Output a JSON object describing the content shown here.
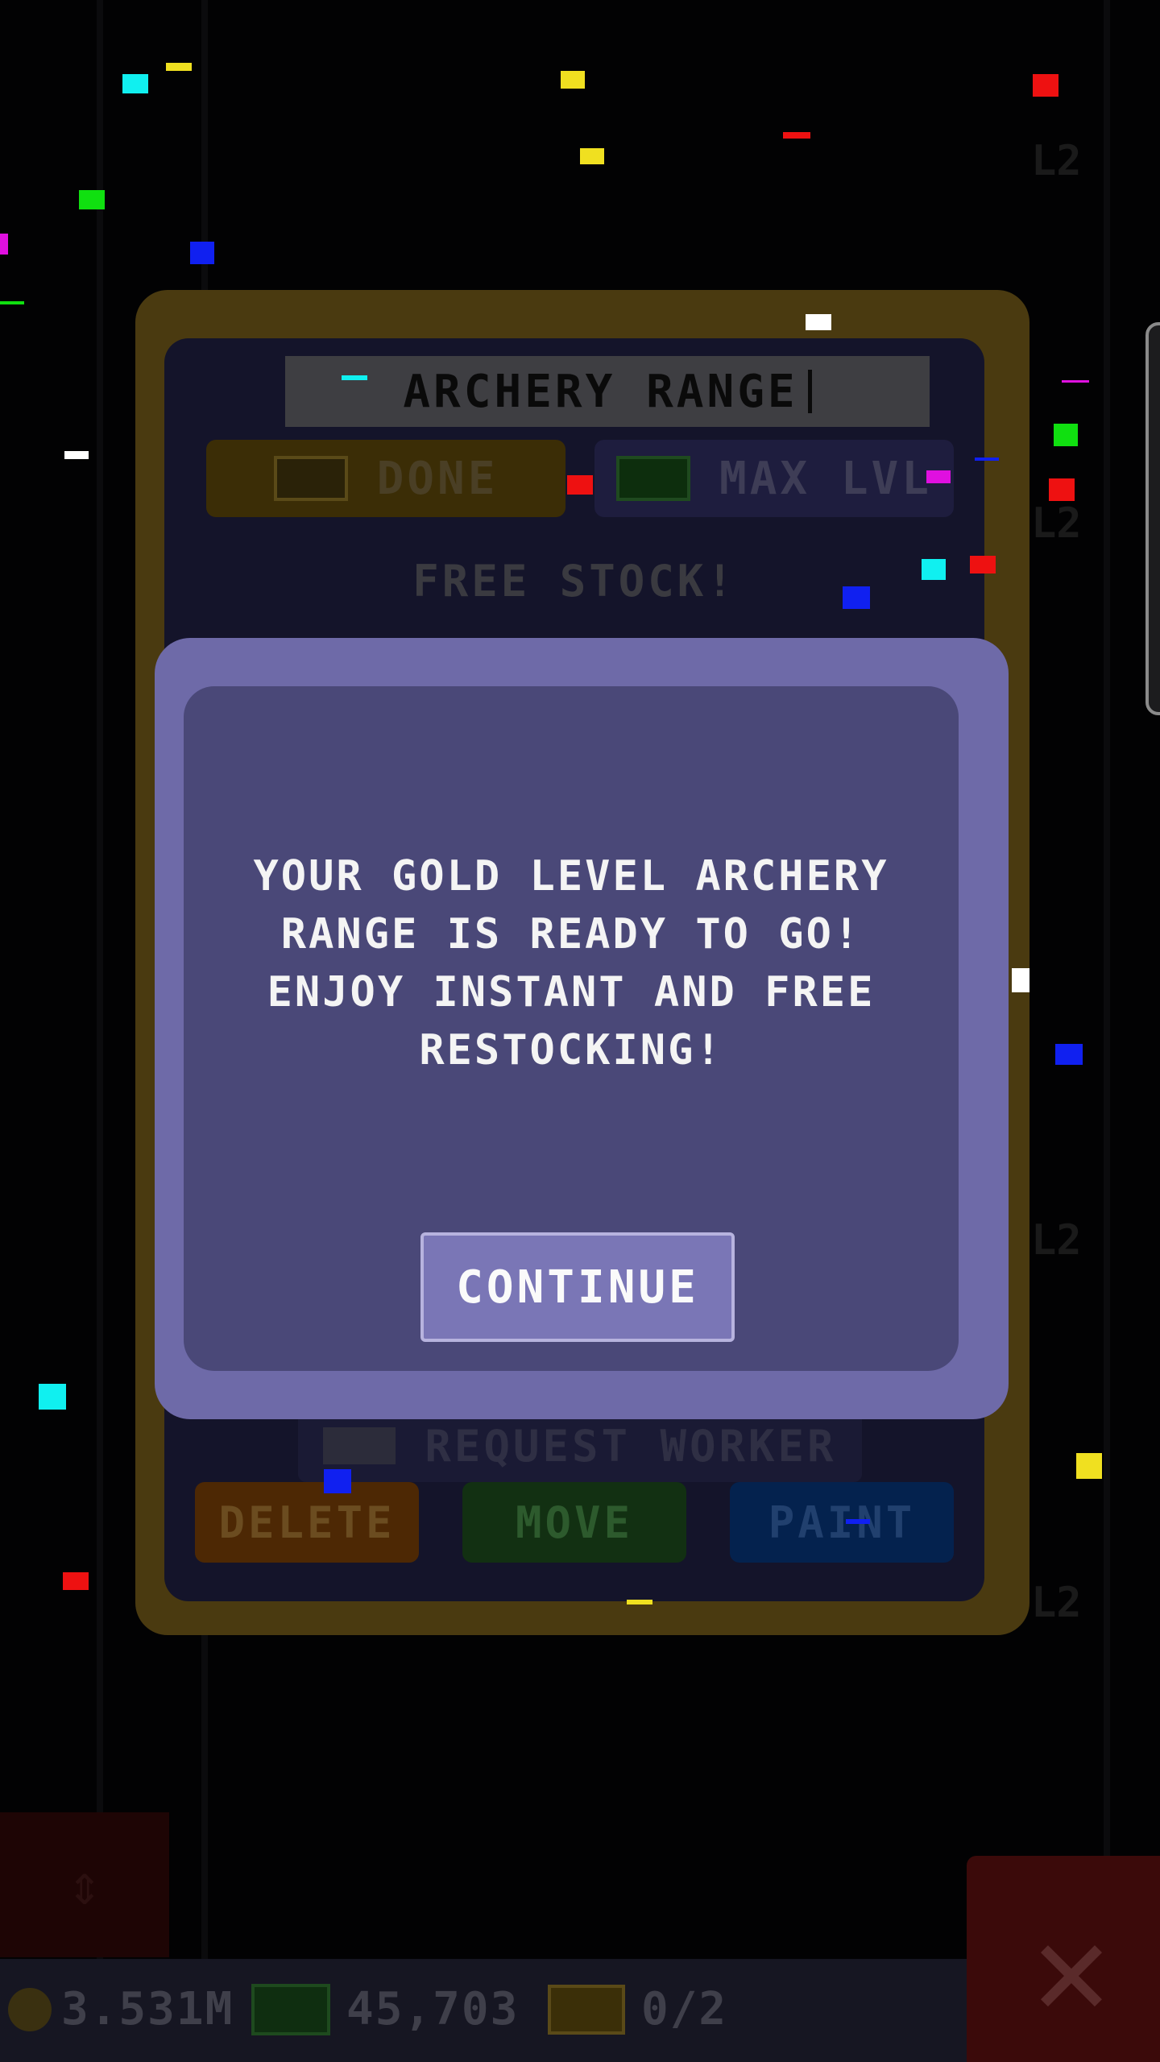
{
  "panel": {
    "title": "ARCHERY RANGE",
    "done_label": "DONE",
    "max_label": "MAX LVL",
    "free_stock": "FREE STOCK!",
    "request_worker": "REQUEST WORKER",
    "delete_label": "DELETE",
    "move_label": "MOVE",
    "paint_label": "PAINT"
  },
  "modal": {
    "line1": "YOUR GOLD LEVEL ARCHERY",
    "line2": "RANGE IS READY TO GO!",
    "line3": "ENJOY INSTANT AND FREE",
    "line4": "RESTOCKING!",
    "continue_label": "CONTINUE"
  },
  "resources": {
    "coins": "3.531M",
    "cash": "45,703",
    "tickets": "0/2"
  },
  "colors": {
    "confetti_red": "#ee1111",
    "confetti_yellow": "#f0e020",
    "confetti_cyan": "#10f0f0",
    "confetti_green": "#10e010",
    "confetti_blue": "#1020f0",
    "confetti_magenta": "#e010e0",
    "confetti_white": "#ffffff"
  },
  "icons": {
    "close": "close-x-icon",
    "coin": "coin-icon",
    "cash": "cash-icon",
    "ticket": "ticket-icon"
  }
}
